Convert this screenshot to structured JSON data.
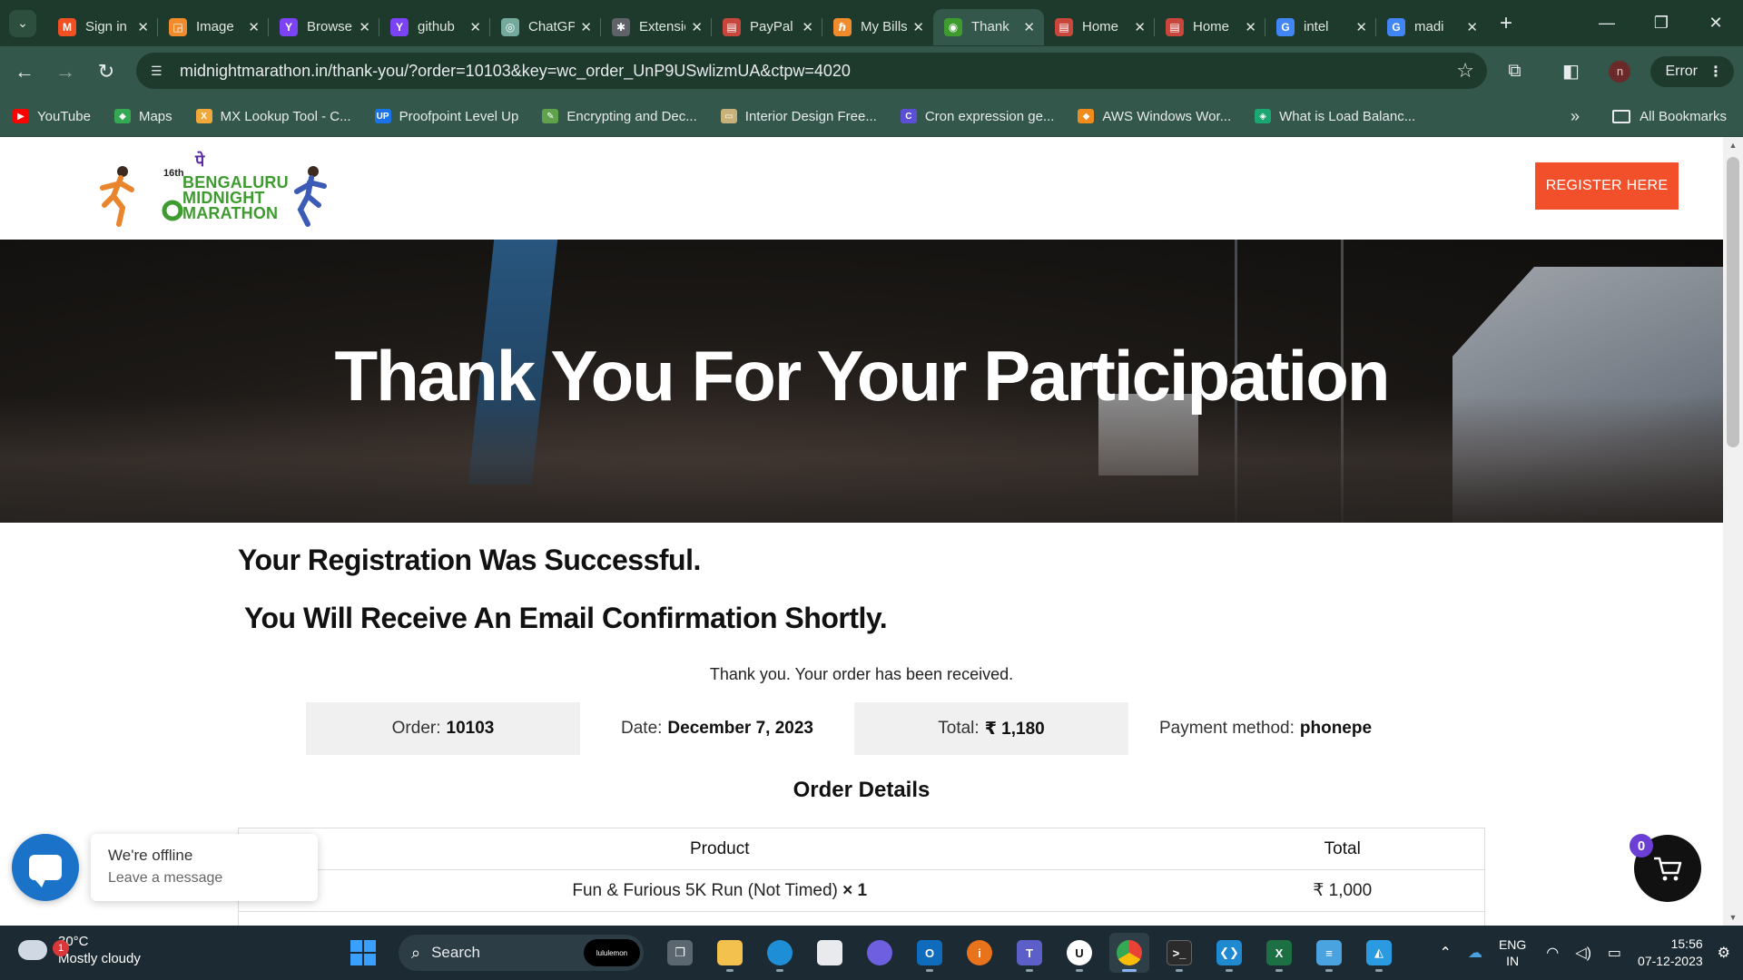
{
  "browser": {
    "tabs": [
      {
        "label": "Sign in",
        "fav": "M",
        "color": "#f25022"
      },
      {
        "label": "Image",
        "fav": "◲",
        "color": "#f28b2c"
      },
      {
        "label": "Browse",
        "fav": "Y",
        "color": "#7b42f6"
      },
      {
        "label": "github",
        "fav": "Y",
        "color": "#7b42f6"
      },
      {
        "label": "ChatGPT",
        "fav": "◎",
        "color": "#74aa9c"
      },
      {
        "label": "Extensions",
        "fav": "✱",
        "color": "#5f6368"
      },
      {
        "label": "PayPal",
        "fav": "▤",
        "color": "#c9463d"
      },
      {
        "label": "My Bills",
        "fav": "ℏ",
        "color": "#f28b2c"
      },
      {
        "label": "Thank",
        "fav": "◉",
        "color": "#3d9b2f"
      },
      {
        "label": "Home",
        "fav": "▤",
        "color": "#c9463d"
      },
      {
        "label": "Home",
        "fav": "▤",
        "color": "#c9463d"
      },
      {
        "label": "intel",
        "fav": "G",
        "color": "#4285f4"
      },
      {
        "label": "madi",
        "fav": "G",
        "color": "#4285f4"
      }
    ],
    "url": "midnightmarathon.in/thank-you/?order=10103&key=wc_order_UnP9USwlizmUA&ctpw=4020",
    "profile_initial": "n",
    "error_label": "Error",
    "bookmarks": [
      {
        "label": "YouTube",
        "color": "#ff0000",
        "icon": "▶"
      },
      {
        "label": "Maps",
        "color": "#34a853",
        "icon": "◆"
      },
      {
        "label": "MX Lookup Tool - C...",
        "color": "#f2a93b",
        "icon": "X"
      },
      {
        "label": "Proofpoint Level Up",
        "color": "#1a73e8",
        "icon": "UP"
      },
      {
        "label": "Encrypting and Dec...",
        "color": "#5fa24b",
        "icon": "✎"
      },
      {
        "label": "Interior Design Free...",
        "color": "#c9b27a",
        "icon": "▭"
      },
      {
        "label": "Cron expression ge...",
        "color": "#5b4fd6",
        "icon": "C"
      },
      {
        "label": "AWS Windows Wor...",
        "color": "#f08c1b",
        "icon": "◆"
      },
      {
        "label": "What is Load Balanc...",
        "color": "#1ba672",
        "icon": "◈"
      }
    ],
    "all_bookmarks": "All Bookmarks"
  },
  "site": {
    "logo": {
      "top_mark": "पे",
      "edition": "16th",
      "line1": "BENGALURU",
      "line2": "MIDNIGHT",
      "line3": "MARATHON"
    },
    "register_label": "REGISTER HERE",
    "hero_title": "Thank You For Your Participation",
    "success_heading": "Your Registration Was Successful.",
    "email_heading": "You Will Receive An Email Confirmation Shortly.",
    "received_text": "Thank you. Your order has been received.",
    "summary": {
      "order_label": "Order:",
      "order_value": "10103",
      "date_label": "Date:",
      "date_value": "December 7, 2023",
      "total_label": "Total:",
      "total_value": "₹  1,180",
      "payment_label": "Payment method:",
      "payment_value": "phonepe"
    },
    "order_details_title": "Order Details",
    "table": {
      "headers": [
        "Product",
        "Total"
      ],
      "rows": [
        {
          "product": "Fun & Furious 5K Run (Not Timed)",
          "qty": "× 1",
          "total": "₹  1,000"
        }
      ]
    },
    "chat": {
      "line1": "We're offline",
      "line2": "Leave a message"
    },
    "cart_count": "0"
  },
  "taskbar": {
    "weather_temp": "30°C",
    "weather_desc": "Mostly cloudy",
    "weather_badge": "1",
    "search_label": "Search",
    "search_pill": "lululemon",
    "lang_line1": "ENG",
    "lang_line2": "IN",
    "time": "15:56",
    "date": "07-12-2023"
  }
}
